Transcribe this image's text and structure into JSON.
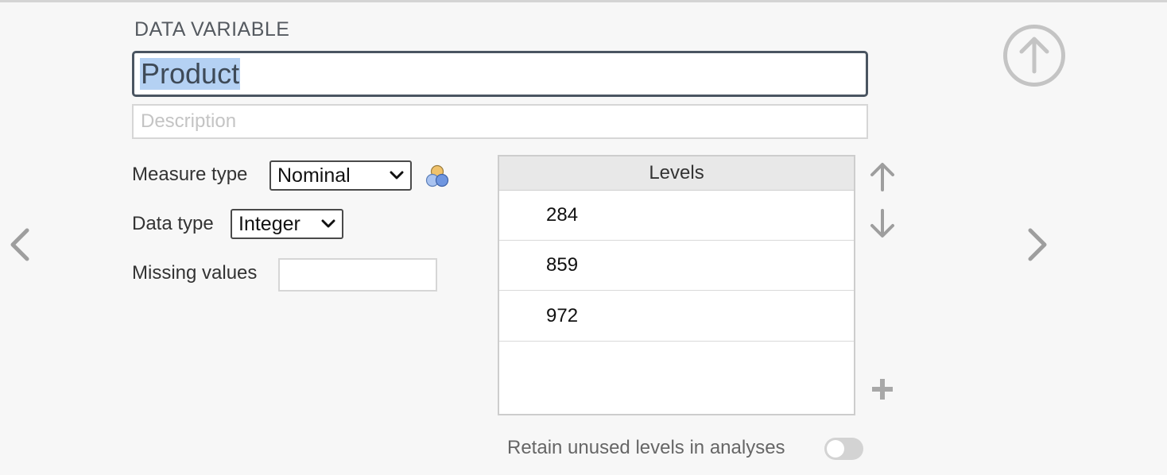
{
  "section": {
    "title": "DATA VARIABLE"
  },
  "variable": {
    "name": "Product",
    "description_placeholder": "Description"
  },
  "measure_type": {
    "label": "Measure type",
    "value": "Nominal"
  },
  "data_type": {
    "label": "Data type",
    "value": "Integer"
  },
  "missing_values": {
    "label": "Missing values",
    "value": ""
  },
  "levels": {
    "header": "Levels",
    "items": [
      "284",
      "859",
      "972"
    ]
  },
  "retain": {
    "label": "Retain unused levels in analyses",
    "enabled": false
  },
  "icons": {
    "up": "arrow-up-circle-icon",
    "prev": "chevron-left-icon",
    "next": "chevron-right-icon",
    "move_up": "arrow-up-icon",
    "move_down": "arrow-down-icon",
    "add": "plus-icon",
    "measure": "nominal-measure-icon"
  },
  "colors": {
    "accent_selection": "#b4d1f3",
    "icon_gray": "#9e9e9e",
    "input_border_focus": "#4a5561"
  }
}
